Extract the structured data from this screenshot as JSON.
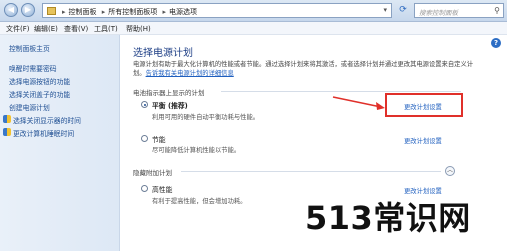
{
  "address": {
    "crumbs": [
      "控制面板",
      "所有控制面板项",
      "电源选项"
    ],
    "search_placeholder": "搜索控制面板"
  },
  "menu": {
    "file": "文件(F)",
    "edit": "编辑(E)",
    "view": "查看(V)",
    "tools": "工具(T)",
    "help": "帮助(H)"
  },
  "leftpane": {
    "home": "控制面板主页",
    "links": [
      "唤醒时需要密码",
      "选择电源按钮的功能",
      "选择关闭盖子的功能",
      "创建电源计划",
      "选择关闭显示器的时间",
      "更改计算机睡眠时间"
    ]
  },
  "main": {
    "title": "选择电源计划",
    "description": "电源计划有助于最大化计算机的性能或者节能。通过选择计划来将其激活，或者选择计划并通过更改其电源设置来自定义计划。",
    "description_link": "告诉我有关电源计划的详细信息",
    "section_shown": "电池指示器上显示的计划",
    "section_hidden": "隐藏附加计划",
    "plans": [
      {
        "name": "平衡 (推荐)",
        "desc": "利用可用的硬件自动平衡功耗与性能。",
        "selected": true
      },
      {
        "name": "节能",
        "desc": "尽可能降低计算机性能以节能。",
        "selected": false
      },
      {
        "name": "高性能",
        "desc": "有利于提高性能，但会增加功耗。",
        "selected": false
      }
    ],
    "change_link": "更改计划设置"
  },
  "watermark": "513常识网",
  "colors": {
    "highlight": "#e0302a",
    "link": "#1f5fbf"
  }
}
